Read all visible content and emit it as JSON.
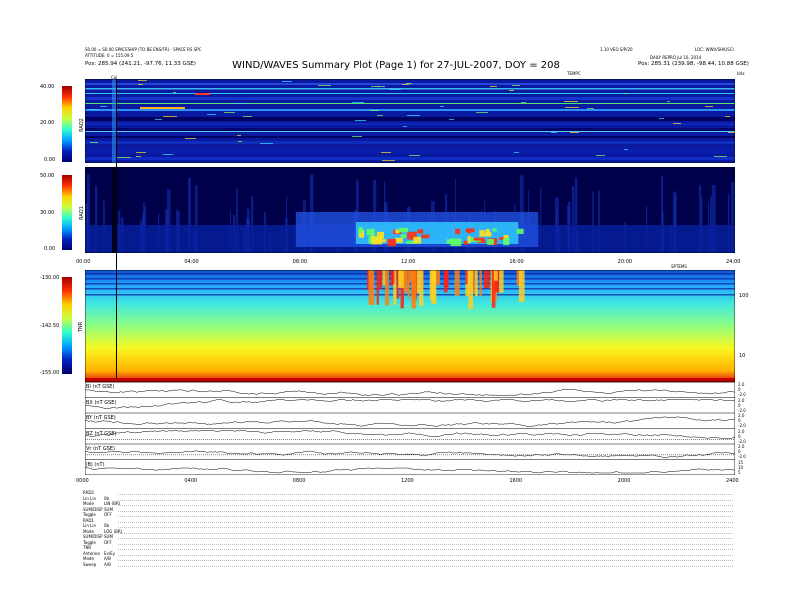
{
  "header": {
    "title": "WIND/WAVES Summary Plot (Page 1) for 27-JUL-2007, DOY = 208",
    "left_line1": "S0.00 = S0.00 SPACESHIP (TO BE ENS/FR) - SPACE RS SPC",
    "left_line2": "ATTITUDE: 0 = 155.09.5",
    "left_line3": "Pos:   285.94 (241.21, -97.76, 11.33 GSE)",
    "right_line1": "LOC: WWV/SHK/SCI",
    "right_line2": "DAILY REPRO Jul 10, 2014",
    "right_line3": "Pos:   285.31 (239.98, -98.44, 10.88 GSE)",
    "center_line": "1.10 VEO S/P/20",
    "mark_label": "Cal",
    "top_right_label": "TEMPC",
    "corner_label": "kHz"
  },
  "colors": {
    "panel_bg": "#0a1aa0",
    "deep": "#00005a",
    "cyan": "#30d8ff",
    "green": "#50ff70",
    "yellow": "#ffe020",
    "red": "#e01010"
  },
  "chart_data": [
    {
      "type": "heatmap",
      "name_label": "RAD2",
      "colorbar_ticks": [
        "40.00",
        "20.00",
        "0.00"
      ],
      "colorbar_range": [
        0,
        40
      ],
      "x_ticks": [],
      "note": "wideband spectrogram, mostly blue with horizontal bands"
    },
    {
      "type": "heatmap",
      "name_label": "RAD1",
      "colorbar_ticks": [
        "50.00",
        "30.00",
        "0.00"
      ],
      "colorbar_range": [
        0,
        50
      ],
      "x_ticks": [
        "00:00",
        "04:00",
        "08:00",
        "12:00",
        "16:00",
        "20:00",
        "24:00"
      ],
      "note": "bursts between 10:00 and 16:00"
    },
    {
      "type": "heatmap",
      "name_label": "TNR",
      "colorbar_ticks": [
        "-130.00",
        "-142.50",
        "-155.00"
      ],
      "colorbar_range": [
        -155,
        -130
      ],
      "right_ticks": [
        "100",
        "10"
      ],
      "x_ticks": [
        "00:00",
        "04:00",
        "08:00",
        "12:00",
        "16:00",
        "20:00",
        "24:00"
      ],
      "top_right_label": "SPTEMS"
    },
    {
      "type": "line",
      "rows": [
        {
          "label": "BI (nT GSE)",
          "right_ticks": [
            "2.0",
            "0",
            "-2.0"
          ]
        },
        {
          "label": "BX (nT GSE)",
          "right_ticks": [
            "2.0",
            "0",
            "-2.0"
          ]
        },
        {
          "label": "BY (nT GSE)",
          "right_ticks": [
            "2.0",
            "0",
            "-2.0"
          ]
        },
        {
          "label": "BZ (nT GSE)",
          "right_ticks": [
            "2.0",
            "0",
            "-2.0"
          ]
        },
        {
          "label": "Vr (nT GSE)",
          "right_ticks": [
            "2.0",
            "0",
            "-2.0"
          ]
        },
        {
          "label": "|B| (nT)",
          "right_ticks": [
            "15",
            "10",
            "5"
          ]
        }
      ],
      "x_ticks": [
        "0000",
        "0400",
        "0800",
        "1200",
        "1600",
        "2000",
        "2400"
      ]
    }
  ],
  "legend": {
    "rows": [
      [
        "RAD2",
        ""
      ],
      [
        "Lin Lin",
        "0b"
      ],
      [
        "Mode",
        "LIN (BR)"
      ],
      [
        "SUM/DISP",
        "SUM"
      ],
      [
        "Toggle",
        "OFF"
      ],
      [
        "RAD1",
        ""
      ],
      [
        "Lin Lin",
        "0b"
      ],
      [
        "Mode",
        "LOG (BR)"
      ],
      [
        "SUM/DISP",
        "SUM"
      ],
      [
        "Toggle",
        "OFF"
      ],
      [
        "TNR",
        ""
      ],
      [
        "Antenna",
        "Ex/Ey"
      ],
      [
        "Mode",
        "A/B"
      ],
      [
        "Sweep",
        "A/B"
      ]
    ]
  }
}
